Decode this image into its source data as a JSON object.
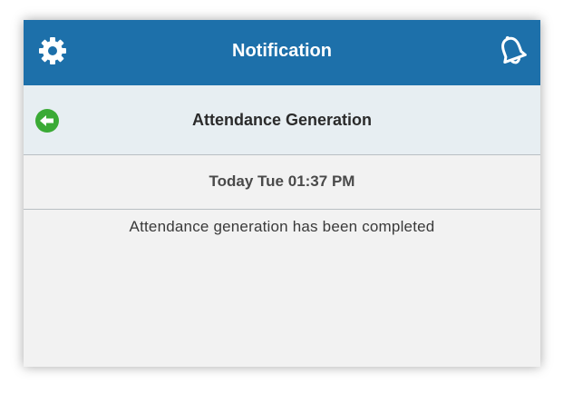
{
  "header": {
    "title": "Notification",
    "left_icon": "gear-icon",
    "right_icon": "bell-icon",
    "background_color": "#1d70aa"
  },
  "subheader": {
    "title": "Attendance Generation",
    "back_icon": "back-arrow-icon",
    "back_icon_color": "#3aaa35"
  },
  "notification": {
    "timestamp": "Today Tue 01:37 PM",
    "message": "Attendance generation has been completed"
  }
}
